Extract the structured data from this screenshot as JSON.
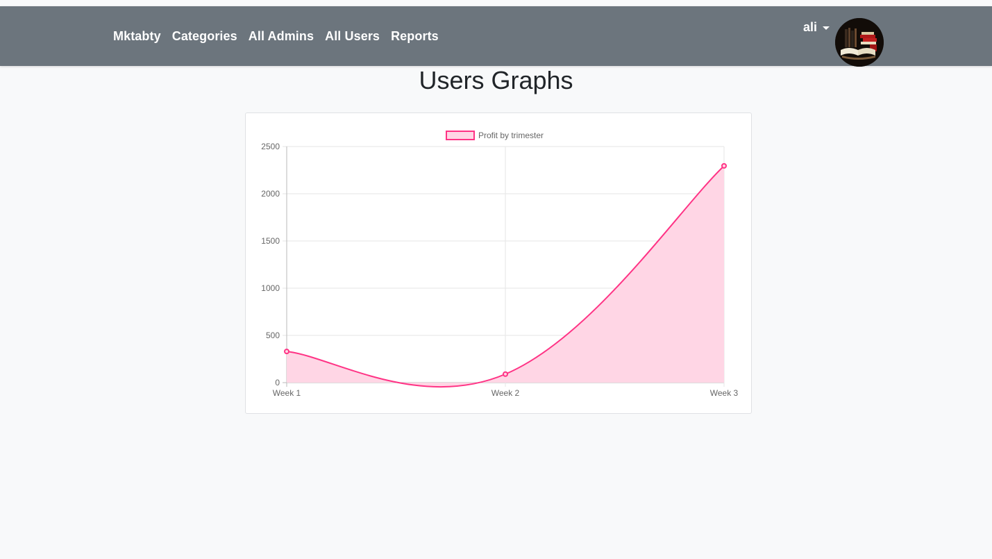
{
  "navbar": {
    "links": [
      "Mktabty",
      "Categories",
      "All Admins",
      "All Users",
      "Reports"
    ],
    "user_name": "ali",
    "background": "#6c757d"
  },
  "page": {
    "title": "Users Graphs"
  },
  "chart_data": {
    "type": "line",
    "title": "",
    "xlabel": "",
    "ylabel": "",
    "categories": [
      "Week 1",
      "Week 2",
      "Week 3"
    ],
    "series": [
      {
        "name": "Profit by trimester",
        "values": [
          330,
          90,
          2295
        ],
        "line_color": "#ff3385",
        "fill_color": "#ffd6e5"
      }
    ],
    "ylim": [
      0,
      2500
    ],
    "yticks": [
      0,
      500,
      1000,
      1500,
      2000,
      2500
    ],
    "grid": true,
    "legend": "top-center",
    "fill": true,
    "curve": "smooth"
  }
}
